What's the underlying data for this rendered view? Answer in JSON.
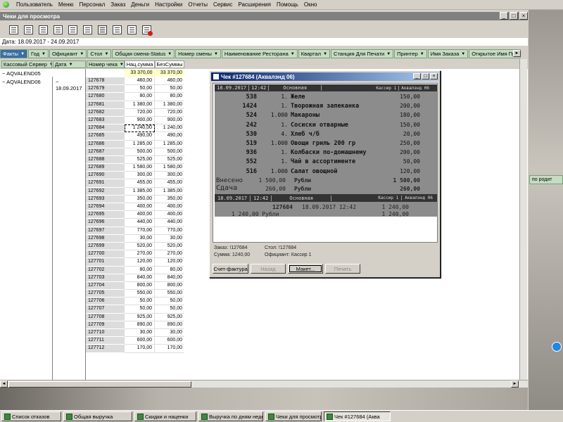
{
  "menu": [
    "Пользователь",
    "Меню",
    "Персонал",
    "Заказ",
    "Деньги",
    "Настройки",
    "Отчеты",
    "Сервис",
    "Расширения",
    "Помощь",
    "Окно"
  ],
  "window": {
    "title": "Чеки для просмотра",
    "date_range": "Дата: 18.09.2017 - 24.09.2017"
  },
  "filters": [
    {
      "label": "Факты",
      "active": true
    },
    {
      "label": "Год"
    },
    {
      "label": "Официант"
    },
    {
      "label": "Стол"
    },
    {
      "label": "Общая смена-Status"
    },
    {
      "label": "Номер смены"
    },
    {
      "label": "Наименование Ресторана"
    },
    {
      "label": "Квартал"
    },
    {
      "label": "Станция Для Печати"
    },
    {
      "label": "Принтер"
    },
    {
      "label": "Имя Заказа"
    },
    {
      "label": "Открытое Имя Причины"
    }
  ],
  "columns": [
    "Кассовый Сервер",
    "Дата",
    "Номер чека",
    "Нац.сумма",
    "БезСуммы"
  ],
  "servers": [
    "AQVALEND05",
    "AQVALEND06"
  ],
  "date_value": "18.09.2017",
  "totals": {
    "v1": "33 370,00",
    "v2": "33 370,00"
  },
  "rows": [
    {
      "num": "127678",
      "v1": "460,00",
      "v2": "460,00"
    },
    {
      "num": "127679",
      "v1": "50,00",
      "v2": "50,00"
    },
    {
      "num": "127680",
      "v1": "80,00",
      "v2": "80,00"
    },
    {
      "num": "127681",
      "v1": "1 380,00",
      "v2": "1 380,00"
    },
    {
      "num": "127682",
      "v1": "720,00",
      "v2": "720,00"
    },
    {
      "num": "127683",
      "v1": "900,00",
      "v2": "900,00"
    },
    {
      "num": "127684",
      "v1": "1 240,00",
      "v2": "1 240,00"
    },
    {
      "num": "127685",
      "v1": "490,00",
      "v2": "490,00"
    },
    {
      "num": "127686",
      "v1": "1 285,00",
      "v2": "1 285,00"
    },
    {
      "num": "127687",
      "v1": "500,00",
      "v2": "500,00"
    },
    {
      "num": "127688",
      "v1": "525,00",
      "v2": "525,00"
    },
    {
      "num": "127689",
      "v1": "1 580,00",
      "v2": "1 580,00"
    },
    {
      "num": "127690",
      "v1": "300,00",
      "v2": "300,00"
    },
    {
      "num": "127691",
      "v1": "455,00",
      "v2": "455,00"
    },
    {
      "num": "127692",
      "v1": "1 385,00",
      "v2": "1 385,00"
    },
    {
      "num": "127693",
      "v1": "350,00",
      "v2": "350,00"
    },
    {
      "num": "127694",
      "v1": "400,00",
      "v2": "400,00"
    },
    {
      "num": "127695",
      "v1": "400,00",
      "v2": "400,00"
    },
    {
      "num": "127696",
      "v1": "440,00",
      "v2": "440,00"
    },
    {
      "num": "127697",
      "v1": "770,00",
      "v2": "770,00"
    },
    {
      "num": "127698",
      "v1": "30,00",
      "v2": "30,00"
    },
    {
      "num": "127699",
      "v1": "520,00",
      "v2": "520,00"
    },
    {
      "num": "127700",
      "v1": "270,00",
      "v2": "270,00"
    },
    {
      "num": "127701",
      "v1": "120,00",
      "v2": "120,00"
    },
    {
      "num": "127702",
      "v1": "80,00",
      "v2": "80,00"
    },
    {
      "num": "127703",
      "v1": "840,00",
      "v2": "840,00"
    },
    {
      "num": "127704",
      "v1": "800,00",
      "v2": "800,00"
    },
    {
      "num": "127705",
      "v1": "550,00",
      "v2": "550,00"
    },
    {
      "num": "127706",
      "v1": "50,00",
      "v2": "50,00"
    },
    {
      "num": "127707",
      "v1": "50,00",
      "v2": "50,00"
    },
    {
      "num": "127708",
      "v1": "925,00",
      "v2": "925,00"
    },
    {
      "num": "127709",
      "v1": "890,00",
      "v2": "890,00"
    },
    {
      "num": "127710",
      "v1": "30,00",
      "v2": "30,00"
    },
    {
      "num": "127711",
      "v1": "600,00",
      "v2": "600,00"
    },
    {
      "num": "127712",
      "v1": "170,00",
      "v2": "170,00"
    }
  ],
  "focused_row": "127684",
  "right_peek_label": "по родит",
  "dialog": {
    "title": "Чек #127684 (Аквалэнд 06)",
    "header": {
      "date": "18.09.2017",
      "time": "12:42",
      "section": "Основная",
      "cashier": "Кассир 1",
      "place": "Аквалэнд 06"
    },
    "items": [
      {
        "id": "538",
        "qty": "1.",
        "name": "Желе",
        "price": "150,00"
      },
      {
        "id": "1424",
        "qty": "1.",
        "name": "Творожная запеканка",
        "price": "200,00"
      },
      {
        "id": "524",
        "qty": "1.000",
        "name": "Макароны",
        "price": "180,00"
      },
      {
        "id": "242",
        "qty": "1.",
        "name": "Сосиски отварные",
        "price": "150,00"
      },
      {
        "id": "530",
        "qty": "4.",
        "name": "Хлеб ч/б",
        "price": "20,00"
      },
      {
        "id": "519",
        "qty": "1.000",
        "name": "Овощи гриль 200 гр",
        "price": "250,00"
      },
      {
        "id": "936",
        "qty": "1.",
        "name": "Колбаски по-домашнему",
        "price": "200,00"
      },
      {
        "id": "552",
        "qty": "1.",
        "name": "Чай в ассортименте",
        "price": "50,00"
      },
      {
        "id": "516",
        "qty": "1.000",
        "name": "Салат овощной",
        "price": "120,00"
      }
    ],
    "paid": {
      "label": "Внесено",
      "amount": "1 500,00",
      "currency": "Рубли",
      "total": "1 500,00"
    },
    "change": {
      "label": "Сдача",
      "amount": "260,00",
      "currency": "Рубли",
      "total": "260,00"
    },
    "header2": {
      "date": "18.09.2017",
      "time": "12:42",
      "section": "Основная",
      "cashier": "Кассир 1",
      "place": "Аквалэнд 06"
    },
    "summary": {
      "check_no": "127684",
      "datetime": "18.09.2017 12:42",
      "sum": "1 240,00",
      "sum_line": "1 240,00 Рубли",
      "sum_right": "1 240,00"
    },
    "info": {
      "order": "Заказ: !127684",
      "table": "Стол: !127684",
      "total": "Сумма: 1240,00",
      "waiter": "Официант: Кассир 1"
    },
    "buttons": {
      "invoice": "Счет-фактура",
      "back": "Назад",
      "layout": "Макет...",
      "print": "Печать"
    }
  },
  "taskbar": [
    "Список отказов",
    "Общая выручка",
    "Скидки и наценки",
    "Выручка по дням неде",
    "Чеки для просмотра",
    "Чек #127684 (Аква"
  ]
}
